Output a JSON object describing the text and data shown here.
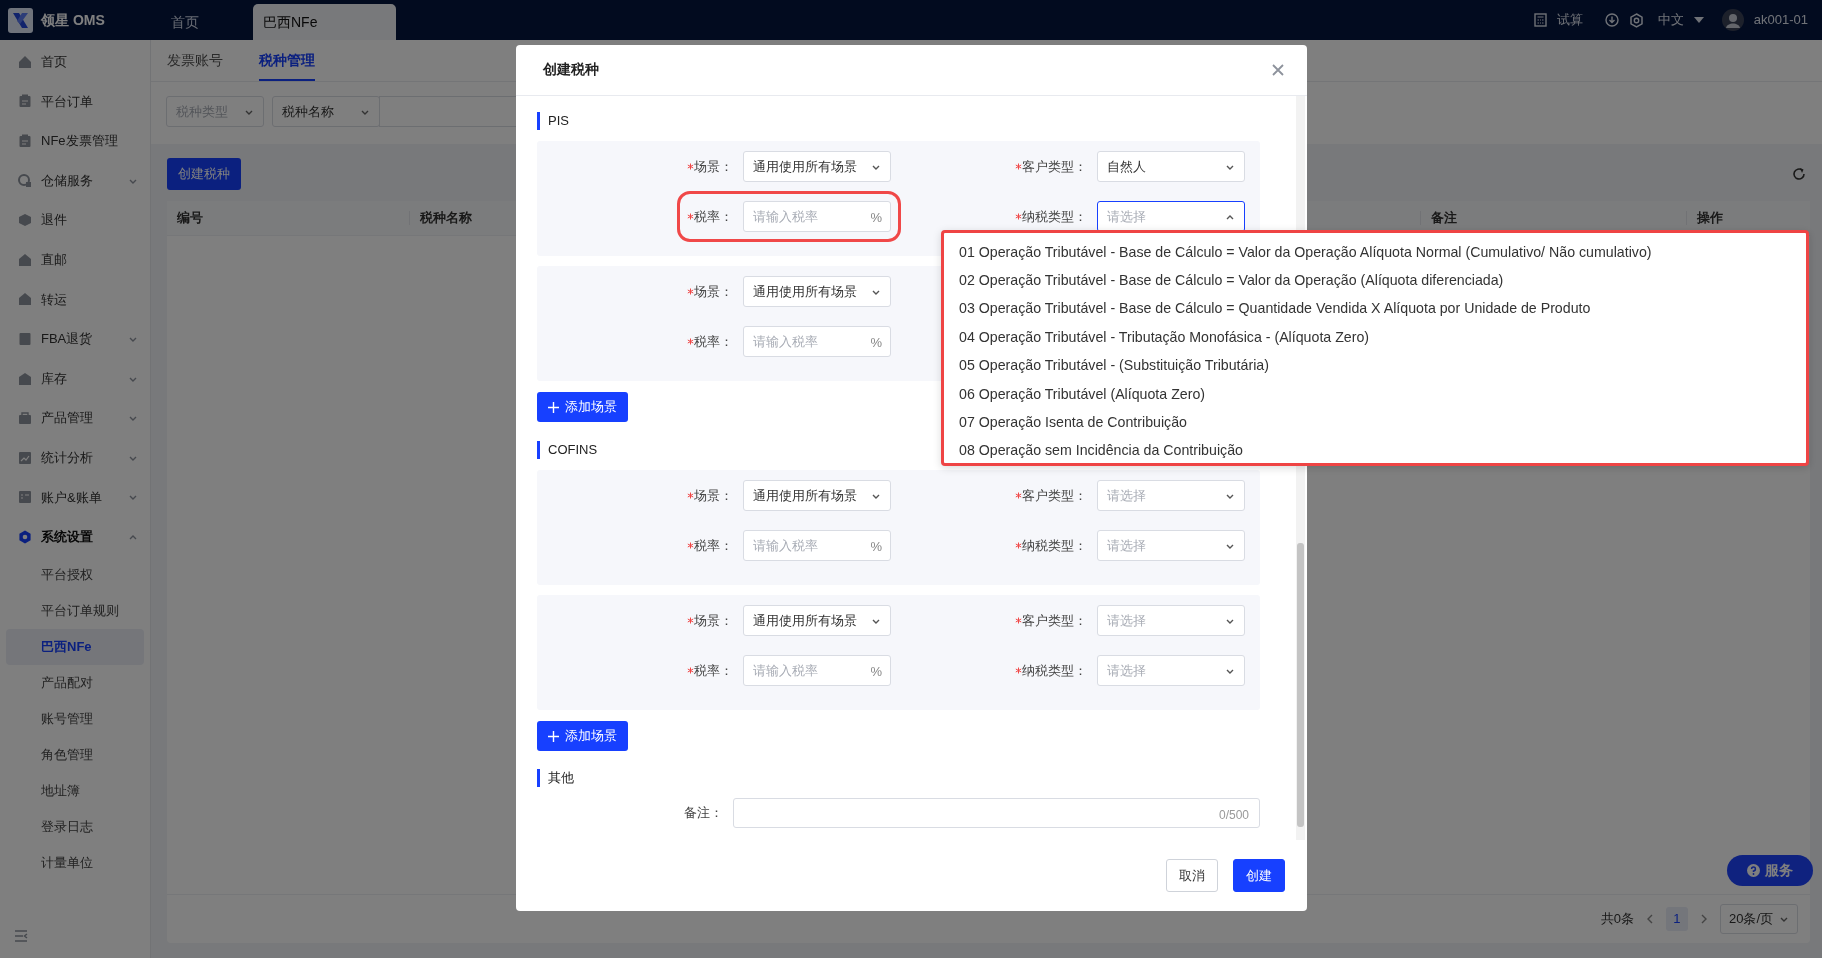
{
  "header": {
    "logo_text": "领星 OMS",
    "tabs": [
      {
        "label": "首页",
        "selected": false
      },
      {
        "label": "巴西NFe",
        "selected": true
      }
    ],
    "calc_label": "试算",
    "language": "中文",
    "user": "ak001-01"
  },
  "sidebar": {
    "items": [
      {
        "label": "首页",
        "kind": "link"
      },
      {
        "label": "平台订单",
        "kind": "link"
      },
      {
        "label": "NFe发票管理",
        "kind": "link"
      },
      {
        "label": "仓储服务",
        "kind": "group",
        "expanded": false
      },
      {
        "label": "退件",
        "kind": "link"
      },
      {
        "label": "直邮",
        "kind": "link"
      },
      {
        "label": "转运",
        "kind": "link"
      },
      {
        "label": "FBA退货",
        "kind": "group",
        "expanded": false
      },
      {
        "label": "库存",
        "kind": "group",
        "expanded": false
      },
      {
        "label": "产品管理",
        "kind": "group",
        "expanded": false
      },
      {
        "label": "统计分析",
        "kind": "group",
        "expanded": false
      },
      {
        "label": "账户&账单",
        "kind": "group",
        "expanded": false
      },
      {
        "label": "系统设置",
        "kind": "group",
        "expanded": true,
        "children": [
          {
            "label": "平台授权",
            "selected": false
          },
          {
            "label": "平台订单规则",
            "selected": false
          },
          {
            "label": "巴西NFe",
            "selected": true
          },
          {
            "label": "产品配对",
            "selected": false
          },
          {
            "label": "账号管理",
            "selected": false
          },
          {
            "label": "角色管理",
            "selected": false
          },
          {
            "label": "地址簿",
            "selected": false
          },
          {
            "label": "登录日志",
            "selected": false
          },
          {
            "label": "计量单位",
            "selected": false
          }
        ]
      }
    ]
  },
  "page": {
    "tabs": [
      {
        "label": "发票账号",
        "selected": false
      },
      {
        "label": "税种管理",
        "selected": true
      }
    ],
    "filters": [
      {
        "kind": "select",
        "placeholder": "税种类型"
      },
      {
        "kind": "select",
        "value": "税种名称"
      },
      {
        "kind": "input"
      }
    ],
    "create_button": "创建税种",
    "table": {
      "columns": [
        "编号",
        "税种名称",
        "备注",
        "操作"
      ]
    },
    "pagination": {
      "total": "共0条",
      "pages": [
        {
          "label": "1",
          "selected": true
        }
      ],
      "page_size": "20条/页"
    },
    "service_button": "服务"
  },
  "modal": {
    "title": "创建税种",
    "sections": [
      {
        "title": "PIS",
        "groups": [
          {
            "rows": [
              [
                {
                  "label": "场景：",
                  "required": true,
                  "kind": "select",
                  "value": "通用使用所有场景",
                  "open": false
                },
                {
                  "label": "客户类型：",
                  "required": true,
                  "kind": "select",
                  "value": "自然人",
                  "open": false
                }
              ],
              [
                {
                  "label": "税率：",
                  "required": true,
                  "kind": "rate",
                  "placeholder": "请输入税率",
                  "suffix": "%",
                  "highlighted": true
                },
                {
                  "label": "纳税类型：",
                  "required": true,
                  "kind": "select",
                  "placeholder": "请选择",
                  "open": true
                }
              ]
            ]
          },
          {
            "rows": [
              [
                {
                  "label": "场景：",
                  "required": true,
                  "kind": "select",
                  "value": "通用使用所有场景",
                  "open": false
                }
              ],
              [
                {
                  "label": "税率：",
                  "required": true,
                  "kind": "rate",
                  "placeholder": "请输入税率",
                  "suffix": "%",
                  "highlighted": false
                }
              ]
            ]
          }
        ],
        "add_button": "添加场景"
      },
      {
        "title": "COFINS",
        "groups": [
          {
            "rows": [
              [
                {
                  "label": "场景：",
                  "required": true,
                  "kind": "select",
                  "value": "通用使用所有场景",
                  "open": false
                },
                {
                  "label": "客户类型：",
                  "required": true,
                  "kind": "select",
                  "placeholder": "请选择",
                  "open": false
                }
              ],
              [
                {
                  "label": "税率：",
                  "required": true,
                  "kind": "rate",
                  "placeholder": "请输入税率",
                  "suffix": "%",
                  "highlighted": false
                },
                {
                  "label": "纳税类型：",
                  "required": true,
                  "kind": "select",
                  "placeholder": "请选择",
                  "open": false
                }
              ]
            ]
          },
          {
            "rows": [
              [
                {
                  "label": "场景：",
                  "required": true,
                  "kind": "select",
                  "value": "通用使用所有场景",
                  "open": false
                },
                {
                  "label": "客户类型：",
                  "required": true,
                  "kind": "select",
                  "placeholder": "请选择",
                  "open": false
                }
              ],
              [
                {
                  "label": "税率：",
                  "required": true,
                  "kind": "rate",
                  "placeholder": "请输入税率",
                  "suffix": "%",
                  "highlighted": false
                },
                {
                  "label": "纳税类型：",
                  "required": true,
                  "kind": "select",
                  "placeholder": "请选择",
                  "open": false
                }
              ]
            ]
          }
        ],
        "add_button": "添加场景"
      },
      {
        "title": "其他",
        "remark": {
          "label": "备注：",
          "counter": "0/500"
        }
      }
    ],
    "buttons": [
      {
        "label": "取消",
        "kind": "secondary"
      },
      {
        "label": "创建",
        "kind": "primary"
      }
    ]
  },
  "dropdown": {
    "highlighted": true,
    "options": [
      {
        "label": "01 Operação Tributável - Base de Cálculo = Valor da Operação Alíquota Normal (Cumulativo/ Não cumulativo)",
        "selected": false
      },
      {
        "label": "02 Operação Tributável - Base de Cálculo = Valor da Operação (Alíquota diferenciada)",
        "selected": false
      },
      {
        "label": "03 Operação Tributável - Base de Cálculo = Quantidade Vendida X Alíquota por Unidade de Produto",
        "selected": false
      },
      {
        "label": "04 Operação Tributável - Tributação Monofásica - (Alíquota Zero)",
        "selected": false
      },
      {
        "label": "05 Operação Tributável - (Substituição Tributária)",
        "selected": false
      },
      {
        "label": "06 Operação Tributável (Alíquota Zero)",
        "selected": false
      },
      {
        "label": "07 Operação Isenta de Contribuição",
        "selected": false
      },
      {
        "label": "08 Operação sem Incidência da Contribuição",
        "selected": false
      }
    ]
  }
}
